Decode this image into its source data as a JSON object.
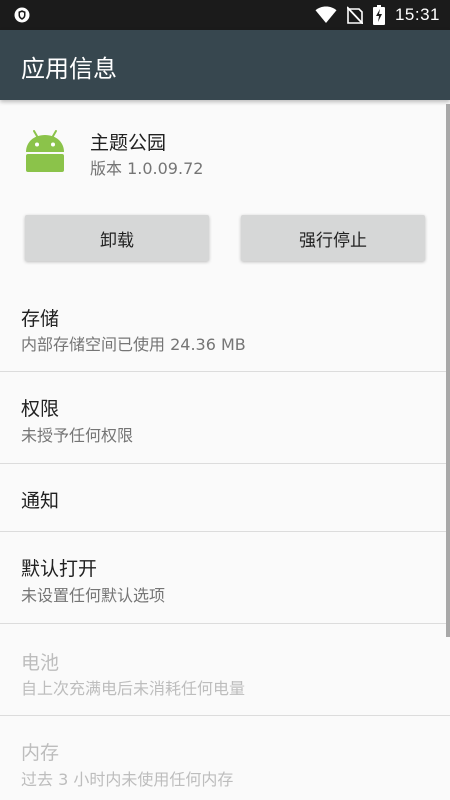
{
  "status_bar": {
    "time": "15:31",
    "icons": [
      "shield-icon",
      "wifi-icon",
      "no-sim-icon",
      "battery-charging-icon"
    ]
  },
  "app_bar": {
    "title": "应用信息"
  },
  "app": {
    "name": "主题公园",
    "version": "版本 1.0.09.72",
    "icon": "android-robot-icon",
    "icon_color": "#8bc34a"
  },
  "actions": {
    "uninstall_label": "卸载",
    "force_stop_label": "强行停止"
  },
  "preferences": [
    {
      "title": "存储",
      "summary": "内部存储空间已使用 24.36 MB",
      "enabled": true
    },
    {
      "title": "权限",
      "summary": "未授予任何权限",
      "enabled": true
    },
    {
      "title": "通知",
      "summary": "",
      "enabled": true
    },
    {
      "title": "默认打开",
      "summary": "未设置任何默认选项",
      "enabled": true
    },
    {
      "title": "电池",
      "summary": "自上次充满电后未消耗任何电量",
      "enabled": false
    },
    {
      "title": "内存",
      "summary": "过去 3 小时内未使用任何内存",
      "enabled": false
    }
  ],
  "colors": {
    "status_bar": "#1b1b1b",
    "app_bar": "#37474f",
    "background": "#fafafa",
    "button": "#d6d7d7"
  }
}
